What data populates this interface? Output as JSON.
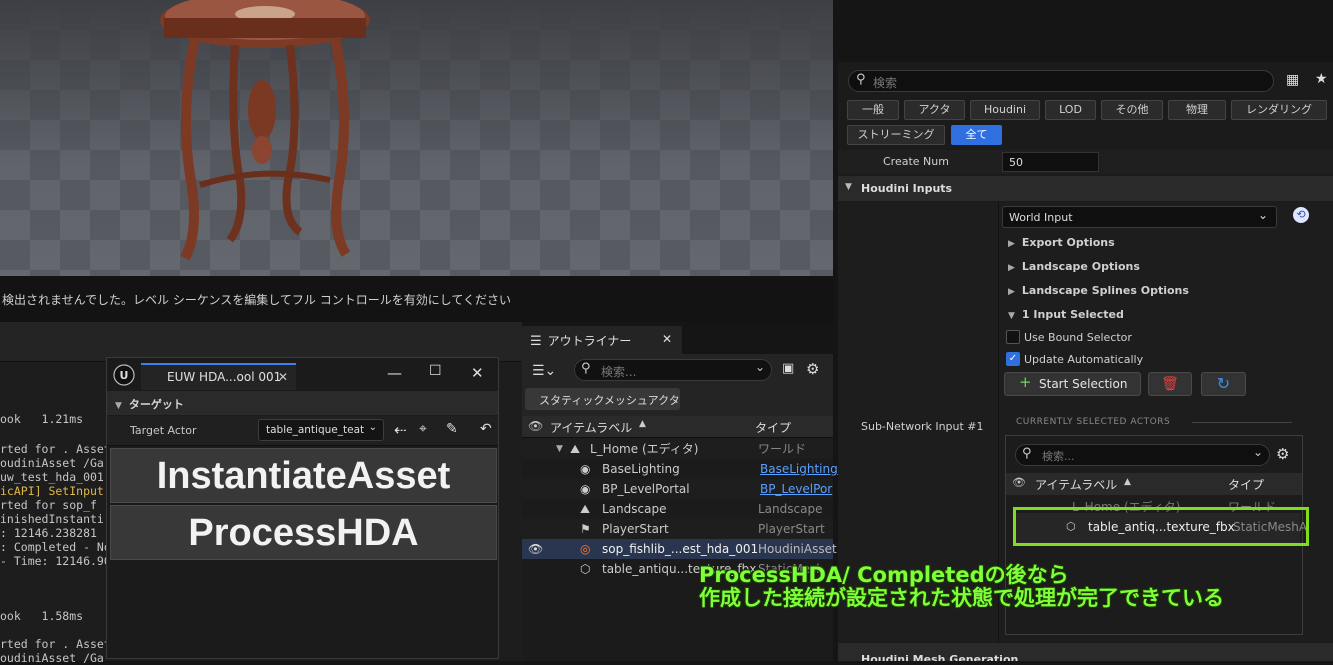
{
  "sequencer_message": "検出されませんでした。レベル シーケンスを編集してフル コントロールを有効にしてください",
  "log_lines": [
    "ook   1.21ms",
    "rted for . Asset",
    "oudiniAsset /Ga",
    "uw_test_hda_001",
    "icAPI] SetInput",
    "rted for sop_f",
    "inishedInstanti",
    ": 12146.238281",
    ": Completed - No",
    "- Time: 12146.90",
    "ook   1.58ms",
    "rted for . Asset",
    "oudiniAsset /Ga"
  ],
  "euw": {
    "tab_title": "EUW HDA...ool 001",
    "section": "ターゲット",
    "target_actor_label": "Target Actor",
    "target_actor_value": "table_antique_teat",
    "btn_instantiate": "InstantiateAsset",
    "btn_process": "ProcessHDA"
  },
  "outliner": {
    "tab_title": "アウトライナー",
    "search_placeholder": "検索...",
    "filter_chip": "スタティックメッシュアクタ",
    "col_label": "アイテムラベル",
    "col_type": "タイプ",
    "rows": [
      {
        "label": "L_Home (エディタ)",
        "type": "ワールド"
      },
      {
        "label": "BaseLighting",
        "type": "BaseLighting"
      },
      {
        "label": "BP_LevelPortal",
        "type": "BP_LevelPor"
      },
      {
        "label": "Landscape",
        "type": "Landscape"
      },
      {
        "label": "PlayerStart",
        "type": "PlayerStart"
      },
      {
        "label": "sop_fishlib_...est_hda_001",
        "type": "HoudiniAsset"
      },
      {
        "label": "table_antiqu...texture_fbx",
        "type": "StaticMesh"
      }
    ]
  },
  "details": {
    "search_placeholder": "検索",
    "tabs": [
      "一般",
      "アクタ",
      "Houdini",
      "LOD",
      "その他",
      "物理",
      "レンダリング",
      "ストリーミング",
      "全て"
    ],
    "create_num_label": "Create Num",
    "create_num_value": "50",
    "houdini_inputs_label": "Houdini Inputs",
    "input_type": "World Input",
    "export_options": "Export Options",
    "landscape_options": "Landscape Options",
    "landscape_splines": "Landscape Splines Options",
    "input_selected": "1 Input Selected",
    "use_bound_selector": "Use Bound Selector",
    "update_automatically": "Update Automatically",
    "start_selection": "Start Selection",
    "subnetwork_label": "Sub-Network Input #1",
    "currently_selected": "CURRENTLY SELECTED ACTORS",
    "inner_search_placeholder": "検索...",
    "inner_col_label": "アイテムラベル",
    "inner_col_type": "タイプ",
    "inner_world_row": "L_Home (エディタ)",
    "inner_world_type": "ワールド",
    "inner_selected_label": "table_antiq...texture_fbx",
    "inner_selected_type": "StaticMeshA",
    "bottom_cut": "Houdini Mesh Generation"
  },
  "annotation": {
    "line1": "ProcessHDA/  Completedの後なら",
    "line2": "作成した接続が設定された状態で処理が完了できている"
  },
  "colors": {
    "accent_blue": "#2f6fe0",
    "annotation_green": "#7fff3a",
    "highlight_box": "#7fdc1e",
    "delete_red": "#e04040"
  }
}
